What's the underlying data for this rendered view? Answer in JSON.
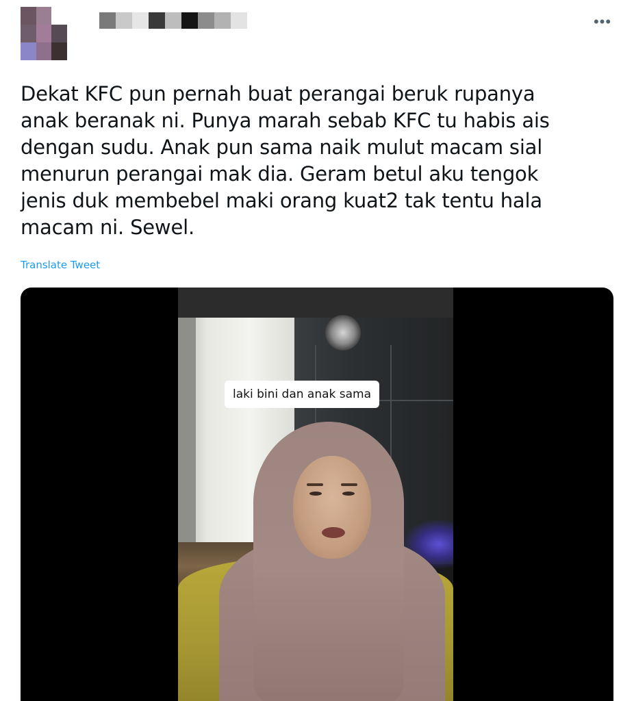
{
  "tweet": {
    "text": "Dekat KFC pun pernah buat perangai beruk rupanya\nanak beranak ni. Punya marah sebab KFC tu habis ais\ndengan sudu. Anak pun sama naik mulut macam sial\nmenurun perangai mak dia. Geram betul aku tengok\njenis duk membebel maki orang kuat2 tak tentu hala\nmacam ni. Sewel.",
    "translate_label": "Translate Tweet",
    "more_label": "•••"
  },
  "media": {
    "caption": "laki bini dan anak sama"
  },
  "avatar": {
    "pixel_colors": [
      "#6b5560",
      "#9a7f93",
      "#ffffff",
      "#6f5d6c",
      "#a27c99",
      "#564a55",
      "#8b86c6",
      "#8f6f8c",
      "#3d3030"
    ]
  },
  "username": {
    "pixel_colors": [
      "#7a7a7a",
      "#c9c9c9",
      "#e6e6e6",
      "#3a3a3a",
      "#bdbdbd",
      "#151515",
      "#8c8c8c",
      "#b2b2b2",
      "#e3e3e3"
    ]
  },
  "colors": {
    "link": "#1d9bf0",
    "text": "#0f1419",
    "media_background": "#000000"
  }
}
